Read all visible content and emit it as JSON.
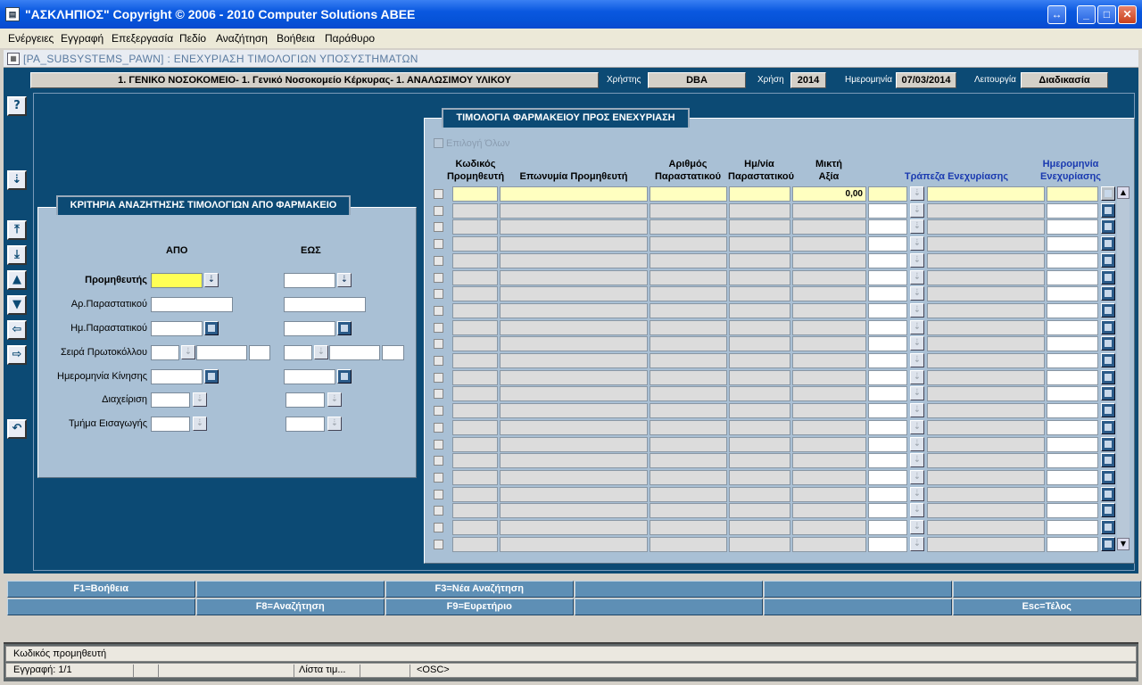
{
  "window": {
    "title": "\"ΑΣΚΛΗΠΙΟΣ\" Copyright © 2006 - 2010 Computer Solutions ABEE",
    "app_icon": "document-icon",
    "controls": [
      "swap-icon",
      "minimize-icon",
      "maximize-icon",
      "close-icon"
    ]
  },
  "menu": [
    "Ενέργειες",
    "Εγγραφή",
    "Επεξεργασία",
    "Πεδίο",
    "Αναζήτηση",
    "Βοήθεια",
    "Παράθυρο"
  ],
  "form": {
    "title": "[PA_SUBSYSTEMS_PAWN]  :  ΕΝΕΧΥΡΙΑΣΗ ΤΙΜΟΛΟΓΙΩΝ ΥΠΟΣΥΣΤΗΜΑΤΩΝ"
  },
  "header": {
    "hospital": "1. ΓΕΝΙΚΟ ΝΟΣΟΚΟΜΕΙΟ- 1. Γενικό Νοσοκομείο Κέρκυρας- 1. ΑΝΑΛΩΣΙΜΟΥ ΥΛΙΚΟΥ",
    "user_label": "Χρήστης",
    "user_value": "DBA",
    "year_label": "Χρήση",
    "year_value": "2014",
    "date_label": "Ημερομηνία",
    "date_value": "07/03/2014",
    "function_label": "Λειτουργία",
    "function_value": "Διαδικασία"
  },
  "side_buttons": [
    "help-icon",
    "lov-down-icon",
    "first-record-icon",
    "last-record-icon",
    "prev-record-icon",
    "next-record-icon",
    "prev-block-icon",
    "next-block-icon",
    "undo-icon"
  ],
  "search_panel": {
    "tab": "ΚΡΙΤΗΡΙΑ ΑΝΑΖΗΤΗΣΗΣ ΤΙΜΟΛΟΓΙΩΝ ΑΠΟ ΦΑΡΜΑΚΕΙΟ",
    "from_label": "ΑΠΟ",
    "to_label": "ΕΩΣ",
    "fields": {
      "supplier": "Προμηθευτής",
      "doc_number": "Αρ.Παραστατικού",
      "doc_date": "Ημ.Παραστατικού",
      "protocol_series": "Σειρά Πρωτοκόλλου",
      "movement_date": "Ημερομηνία Κίνησης",
      "management": "Διαχείριση",
      "import_dept": "Τμήμα Εισαγωγής"
    }
  },
  "invoices_panel": {
    "tab": "ΤΙΜΟΛΟΓΙΑ ΦΑΡΜΑΚΕΙΟΥ ΠΡΟΣ ΕΝΕΧΥΡΙΑΣΗ",
    "select_all": "Επιλογή Όλων",
    "columns": {
      "code1": "Κωδικός",
      "code2": "Προμηθευτή",
      "name": "Επωνυμία Προμηθευτή",
      "docnum1": "Αριθμός",
      "docnum2": "Παραστατικού",
      "docdate1": "Ημ/νία",
      "docdate2": "Παραστατικού",
      "gross1": "Μικτή",
      "gross2": "Αξία",
      "bank": "Τράπεζα Ενεχυρίασης",
      "pawndate1": "Ημερομηνία",
      "pawndate2": "Ενεχυρίασης"
    },
    "first_row_gross": "0,00"
  },
  "function_keys": {
    "row1": [
      "F1=Βοήθεια",
      "",
      "F3=Νέα Αναζήτηση",
      "",
      "",
      ""
    ],
    "row2": [
      "",
      "F8=Αναζήτηση",
      "F9=Ευρετήριο",
      "",
      "",
      "Esc=Τέλος"
    ]
  },
  "status_bar": {
    "message": "Κωδικός προμηθευτή",
    "record": "Εγγραφή: 1/1",
    "list": "Λίστα τιμ...",
    "osc": "<OSC>"
  }
}
